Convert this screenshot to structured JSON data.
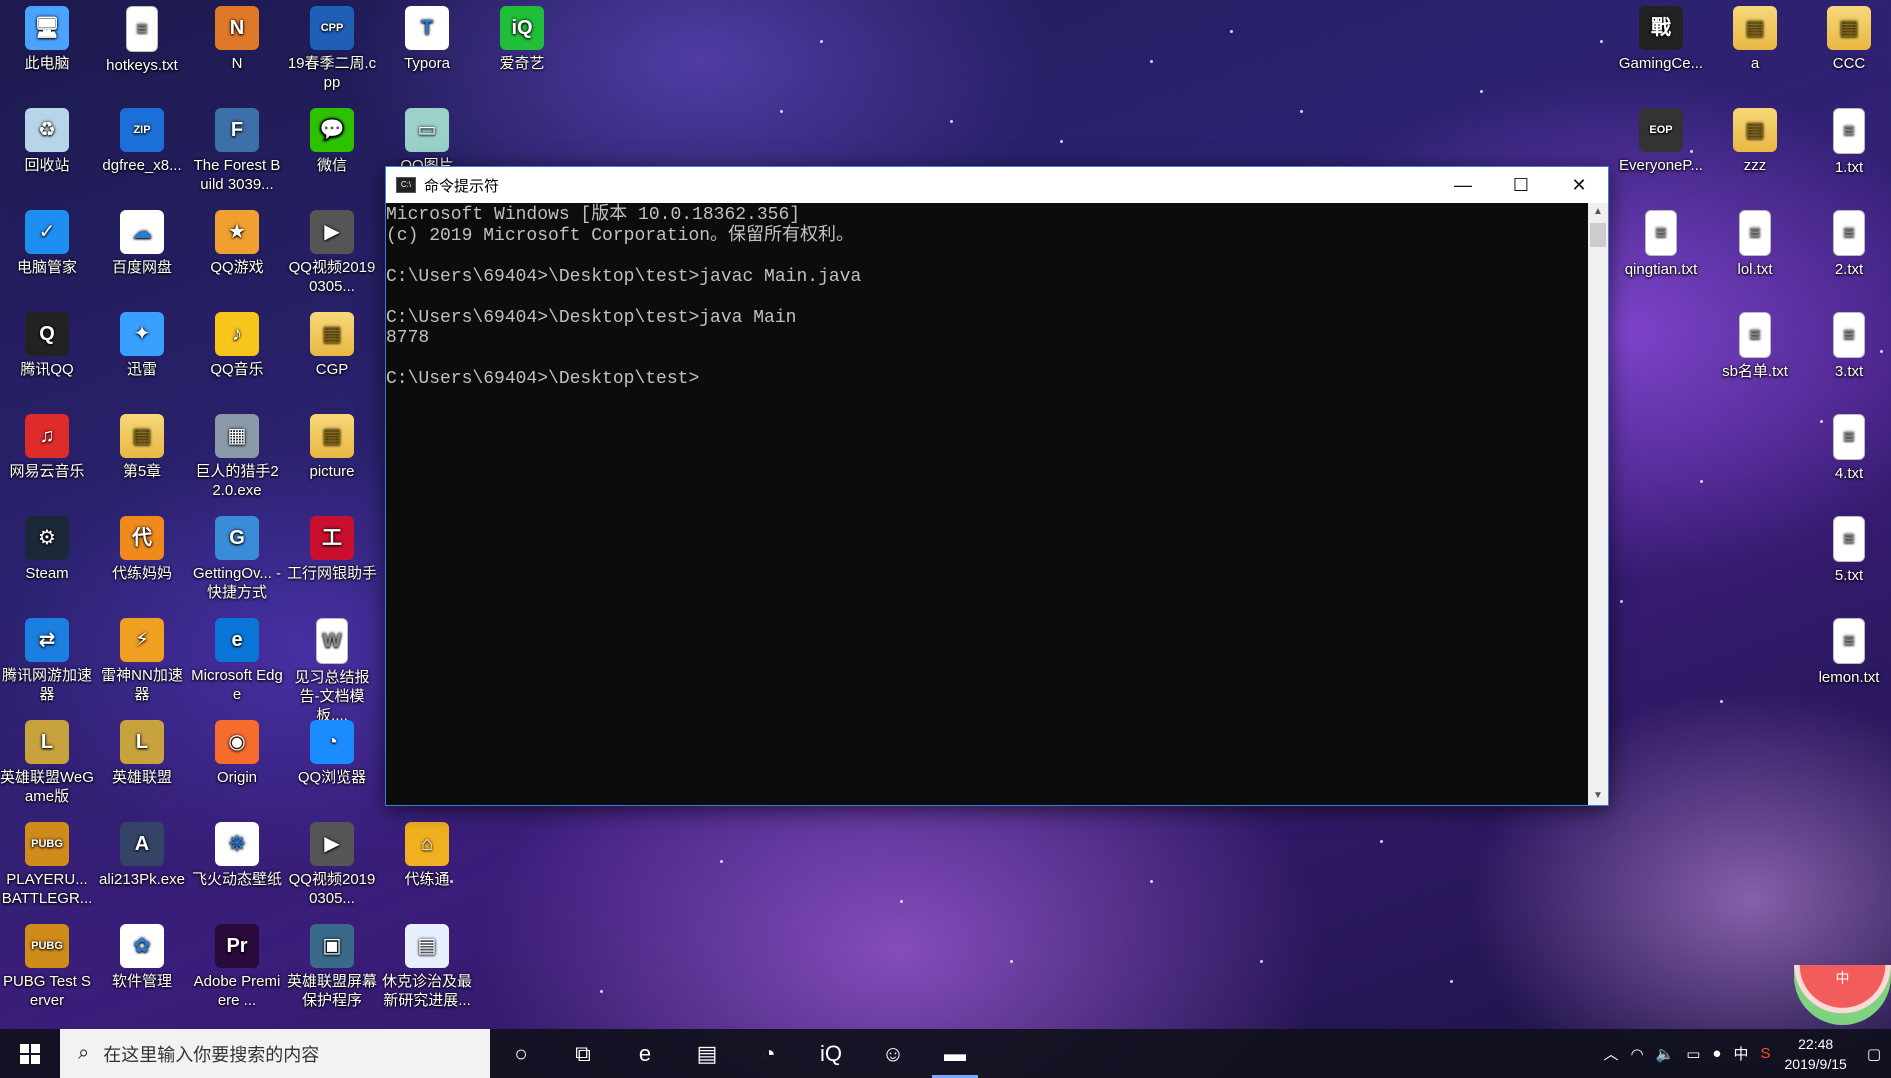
{
  "desktop": {
    "left_icons": [
      {
        "label": "此电脑",
        "name": "this-pc",
        "icon": "computer-icon",
        "color": "#4aa3ff",
        "glyph": "🖥"
      },
      {
        "label": "hotkeys.txt",
        "name": "hotkeys-txt",
        "icon": "text-file-icon",
        "color": "#ffffff",
        "glyph": "≡"
      },
      {
        "label": "N",
        "name": "n-app",
        "icon": "naruto-icon",
        "color": "#e0782a",
        "glyph": "N"
      },
      {
        "label": "19春季二周.cpp",
        "name": "cpp-file",
        "icon": "cpp-file-icon",
        "color": "#1f5fb5",
        "glyph": "CPP"
      },
      {
        "label": "Typora",
        "name": "typora",
        "icon": "typora-icon",
        "color": "#ffffff",
        "glyph": "T"
      },
      {
        "label": "爱奇艺",
        "name": "iqiyi",
        "icon": "iqiyi-icon",
        "color": "#1fbf3a",
        "glyph": "iQ"
      },
      {
        "label": "回收站",
        "name": "recycle-bin",
        "icon": "recycle-bin-icon",
        "color": "#b8d4e8",
        "glyph": "♻"
      },
      {
        "label": "dgfree_x8...",
        "name": "dgfree",
        "icon": "zip-icon",
        "color": "#1b6fd8",
        "glyph": "ZIP"
      },
      {
        "label": "The Forest Build 3039...",
        "name": "the-forest",
        "icon": "the-forest-icon",
        "color": "#3d6fa8",
        "glyph": "F"
      },
      {
        "label": "微信",
        "name": "wechat",
        "icon": "wechat-icon",
        "color": "#2dc100",
        "glyph": "💬"
      },
      {
        "label": "QQ图片",
        "name": "qq-image",
        "icon": "image-icon",
        "color": "#9ad1c8",
        "glyph": "▭"
      },
      {
        "label": "电脑管家",
        "name": "pc-manager",
        "icon": "shield-icon",
        "color": "#1d8ff0",
        "glyph": "✓"
      },
      {
        "label": "百度网盘",
        "name": "baidu-netdisk",
        "icon": "cloud-icon",
        "color": "#ffffff",
        "glyph": "☁"
      },
      {
        "label": "QQ游戏",
        "name": "qq-game",
        "icon": "qq-game-icon",
        "color": "#f0a030",
        "glyph": "★"
      },
      {
        "label": "QQ视频20190305...",
        "name": "qq-video-1",
        "icon": "video-icon",
        "color": "#555555",
        "glyph": "▶"
      },
      {
        "label": "腾讯QQ",
        "name": "tencent-qq",
        "icon": "qq-penguin-icon",
        "color": "#222222",
        "glyph": "Q"
      },
      {
        "label": "迅雷",
        "name": "xunlei",
        "icon": "xunlei-icon",
        "color": "#3aa0ff",
        "glyph": "✦"
      },
      {
        "label": "QQ音乐",
        "name": "qq-music",
        "icon": "qq-music-icon",
        "color": "#f7c51c",
        "glyph": "♪"
      },
      {
        "label": "CGP",
        "name": "cgp",
        "icon": "folder-zip-icon",
        "color": "#e8c35a",
        "glyph": "▤"
      },
      {
        "label": "网易云音乐",
        "name": "netease-music",
        "icon": "netease-music-icon",
        "color": "#e02b2b",
        "glyph": "♫"
      },
      {
        "label": "第5章",
        "name": "chapter-5",
        "icon": "folder-icon",
        "color": "#f5d36f",
        "glyph": "▤"
      },
      {
        "label": "巨人的猎手22.0.exe",
        "name": "giant-hunter",
        "icon": "exe-icon",
        "color": "#8a9aa8",
        "glyph": "▦"
      },
      {
        "label": "picture",
        "name": "picture-folder",
        "icon": "folder-icon",
        "color": "#f5d36f",
        "glyph": "▤"
      },
      {
        "label": "Steam",
        "name": "steam",
        "icon": "steam-icon",
        "color": "#1b2838",
        "glyph": "⚙"
      },
      {
        "label": "代练妈妈",
        "name": "dailian-mama",
        "icon": "dailian-icon",
        "color": "#f08a1c",
        "glyph": "代"
      },
      {
        "label": "GettingOv... - 快捷方式",
        "name": "getting-over-it",
        "icon": "game-icon",
        "color": "#3a8bd8",
        "glyph": "G"
      },
      {
        "label": "工行网银助手",
        "name": "icbc-helper",
        "icon": "icbc-icon",
        "color": "#c8102e",
        "glyph": "工"
      },
      {
        "label": "腾讯网游加速器",
        "name": "tencent-accelerator",
        "icon": "accelerator-icon",
        "color": "#1a7fe0",
        "glyph": "⇄"
      },
      {
        "label": "雷神NN加速器",
        "name": "leishen-nn",
        "icon": "leishen-icon",
        "color": "#f0a020",
        "glyph": "⚡"
      },
      {
        "label": "Microsoft Edge",
        "name": "microsoft-edge",
        "icon": "edge-icon",
        "color": "#0a76d8",
        "glyph": "e"
      },
      {
        "label": "见习总结报告-文档模板....",
        "name": "report-doc",
        "icon": "word-doc-icon",
        "color": "#ffffff",
        "glyph": "W"
      },
      {
        "label": "英雄联盟WeGame版",
        "name": "lol-wegame",
        "icon": "lol-icon",
        "color": "#c8a23c",
        "glyph": "L"
      },
      {
        "label": "英雄联盟",
        "name": "lol",
        "icon": "lol-icon",
        "color": "#c8a23c",
        "glyph": "L"
      },
      {
        "label": "Origin",
        "name": "origin",
        "icon": "origin-icon",
        "color": "#f56c2d",
        "glyph": "◉"
      },
      {
        "label": "QQ浏览器",
        "name": "qq-browser",
        "icon": "qq-browser-icon",
        "color": "#1a8cff",
        "glyph": "◔"
      },
      {
        "label": "PLAYERU... BATTLEGR...",
        "name": "pubg",
        "icon": "pubg-icon",
        "color": "#d08c1a",
        "glyph": "PUBG"
      },
      {
        "label": "ali213Pk.exe",
        "name": "ali213",
        "icon": "ali213-icon",
        "color": "#334466",
        "glyph": "A"
      },
      {
        "label": "飞火动态壁纸",
        "name": "feihuo-wallpaper",
        "icon": "wallpaper-icon",
        "color": "#ffffff",
        "glyph": "❋"
      },
      {
        "label": "QQ视频20190305...",
        "name": "qq-video-2",
        "icon": "video-icon",
        "color": "#555555",
        "glyph": "▶"
      },
      {
        "label": "代练通",
        "name": "dailiantong",
        "icon": "dailiantong-icon",
        "color": "#f0b020",
        "glyph": "⌂"
      },
      {
        "label": "PUBG Test Server",
        "name": "pubg-test",
        "icon": "pubg-icon",
        "color": "#d08c1a",
        "glyph": "PUBG"
      },
      {
        "label": "软件管理",
        "name": "software-manager",
        "icon": "software-manager-icon",
        "color": "#ffffff",
        "glyph": "✿"
      },
      {
        "label": "Adobe Premiere ...",
        "name": "adobe-premiere",
        "icon": "premiere-icon",
        "color": "#2a0a3a",
        "glyph": "Pr"
      },
      {
        "label": "英雄联盟屏幕保护程序",
        "name": "lol-screensaver",
        "icon": "screensaver-icon",
        "color": "#3a6a8a",
        "glyph": "▣"
      },
      {
        "label": "休克诊治及最新研究进展...",
        "name": "shock-doc",
        "icon": "image-doc-icon",
        "color": "#e8f0ff",
        "glyph": "▤"
      }
    ],
    "right_icons": [
      {
        "label": "GamingCe...",
        "name": "gaming-center",
        "icon": "gaming-center-icon",
        "color": "#222222",
        "glyph": "戰"
      },
      {
        "label": "a",
        "name": "a-folder",
        "icon": "folder-icon",
        "color": "#f5d36f",
        "glyph": "▤"
      },
      {
        "label": "CCC",
        "name": "ccc-folder",
        "icon": "folder-icon",
        "color": "#f5d36f",
        "glyph": "▤"
      },
      {
        "label": "EveryoneP...",
        "name": "everyone-piano",
        "icon": "piano-icon",
        "color": "#333333",
        "glyph": "EOP"
      },
      {
        "label": "zzz",
        "name": "zzz-folder",
        "icon": "folder-icon",
        "color": "#f5d36f",
        "glyph": "▤"
      },
      {
        "label": "1.txt",
        "name": "txt-1",
        "icon": "text-file-icon",
        "color": "#ffffff",
        "glyph": "≡"
      },
      {
        "label": "qingtian.txt",
        "name": "qingtian-txt",
        "icon": "text-file-icon",
        "color": "#ffffff",
        "glyph": "≡"
      },
      {
        "label": "lol.txt",
        "name": "lol-txt",
        "icon": "text-file-icon",
        "color": "#ffffff",
        "glyph": "≡"
      },
      {
        "label": "2.txt",
        "name": "txt-2",
        "icon": "text-file-icon",
        "color": "#ffffff",
        "glyph": "≡"
      },
      {
        "label": "sb名单.txt",
        "name": "sb-list-txt",
        "icon": "text-file-icon",
        "color": "#ffffff",
        "glyph": "≡"
      },
      {
        "label": "3.txt",
        "name": "txt-3",
        "icon": "text-file-icon",
        "color": "#ffffff",
        "glyph": "≡"
      },
      {
        "label": "4.txt",
        "name": "txt-4",
        "icon": "text-file-icon",
        "color": "#ffffff",
        "glyph": "≡"
      },
      {
        "label": "5.txt",
        "name": "txt-5",
        "icon": "text-file-icon",
        "color": "#ffffff",
        "glyph": "≡"
      },
      {
        "label": "lemon.txt",
        "name": "lemon-txt",
        "icon": "text-file-icon",
        "color": "#ffffff",
        "glyph": "≡"
      }
    ]
  },
  "cmd": {
    "title": "命令提示符",
    "icon_glyph": "C:\\",
    "lines": [
      "Microsoft Windows [版本 10.0.18362.356]",
      "(c) 2019 Microsoft Corporation。保留所有权利。",
      "",
      "C:\\Users\\69404>\\Desktop\\test>javac Main.java",
      "",
      "C:\\Users\\69404>\\Desktop\\test>java Main",
      "8778",
      "",
      "C:\\Users\\69404>\\Desktop\\test>"
    ],
    "minimize_glyph": "—",
    "maximize_glyph": "☐",
    "close_glyph": "✕"
  },
  "taskbar": {
    "search_placeholder": "在这里输入你要搜索的内容",
    "time": "22:48",
    "date": "2019/9/15",
    "ime": "中",
    "apps": [
      {
        "name": "cortana-button",
        "icon": "cortana-icon",
        "glyph": "○",
        "active": false
      },
      {
        "name": "task-view-button",
        "icon": "task-view-icon",
        "glyph": "⧉",
        "active": false
      },
      {
        "name": "taskbar-edge",
        "icon": "edge-icon",
        "glyph": "e",
        "active": false
      },
      {
        "name": "taskbar-file-explorer",
        "icon": "folder-icon",
        "glyph": "▤",
        "active": false
      },
      {
        "name": "taskbar-qq-browser",
        "icon": "qq-browser-icon",
        "glyph": "◔",
        "active": false
      },
      {
        "name": "taskbar-iqiyi",
        "icon": "iqiyi-icon",
        "glyph": "iQ",
        "active": false
      },
      {
        "name": "taskbar-avatar-app",
        "icon": "avatar-icon",
        "glyph": "☺",
        "active": false
      },
      {
        "name": "taskbar-cmd",
        "icon": "cmd-icon",
        "glyph": "▬",
        "active": true
      }
    ]
  },
  "widget": {
    "label": "中"
  }
}
